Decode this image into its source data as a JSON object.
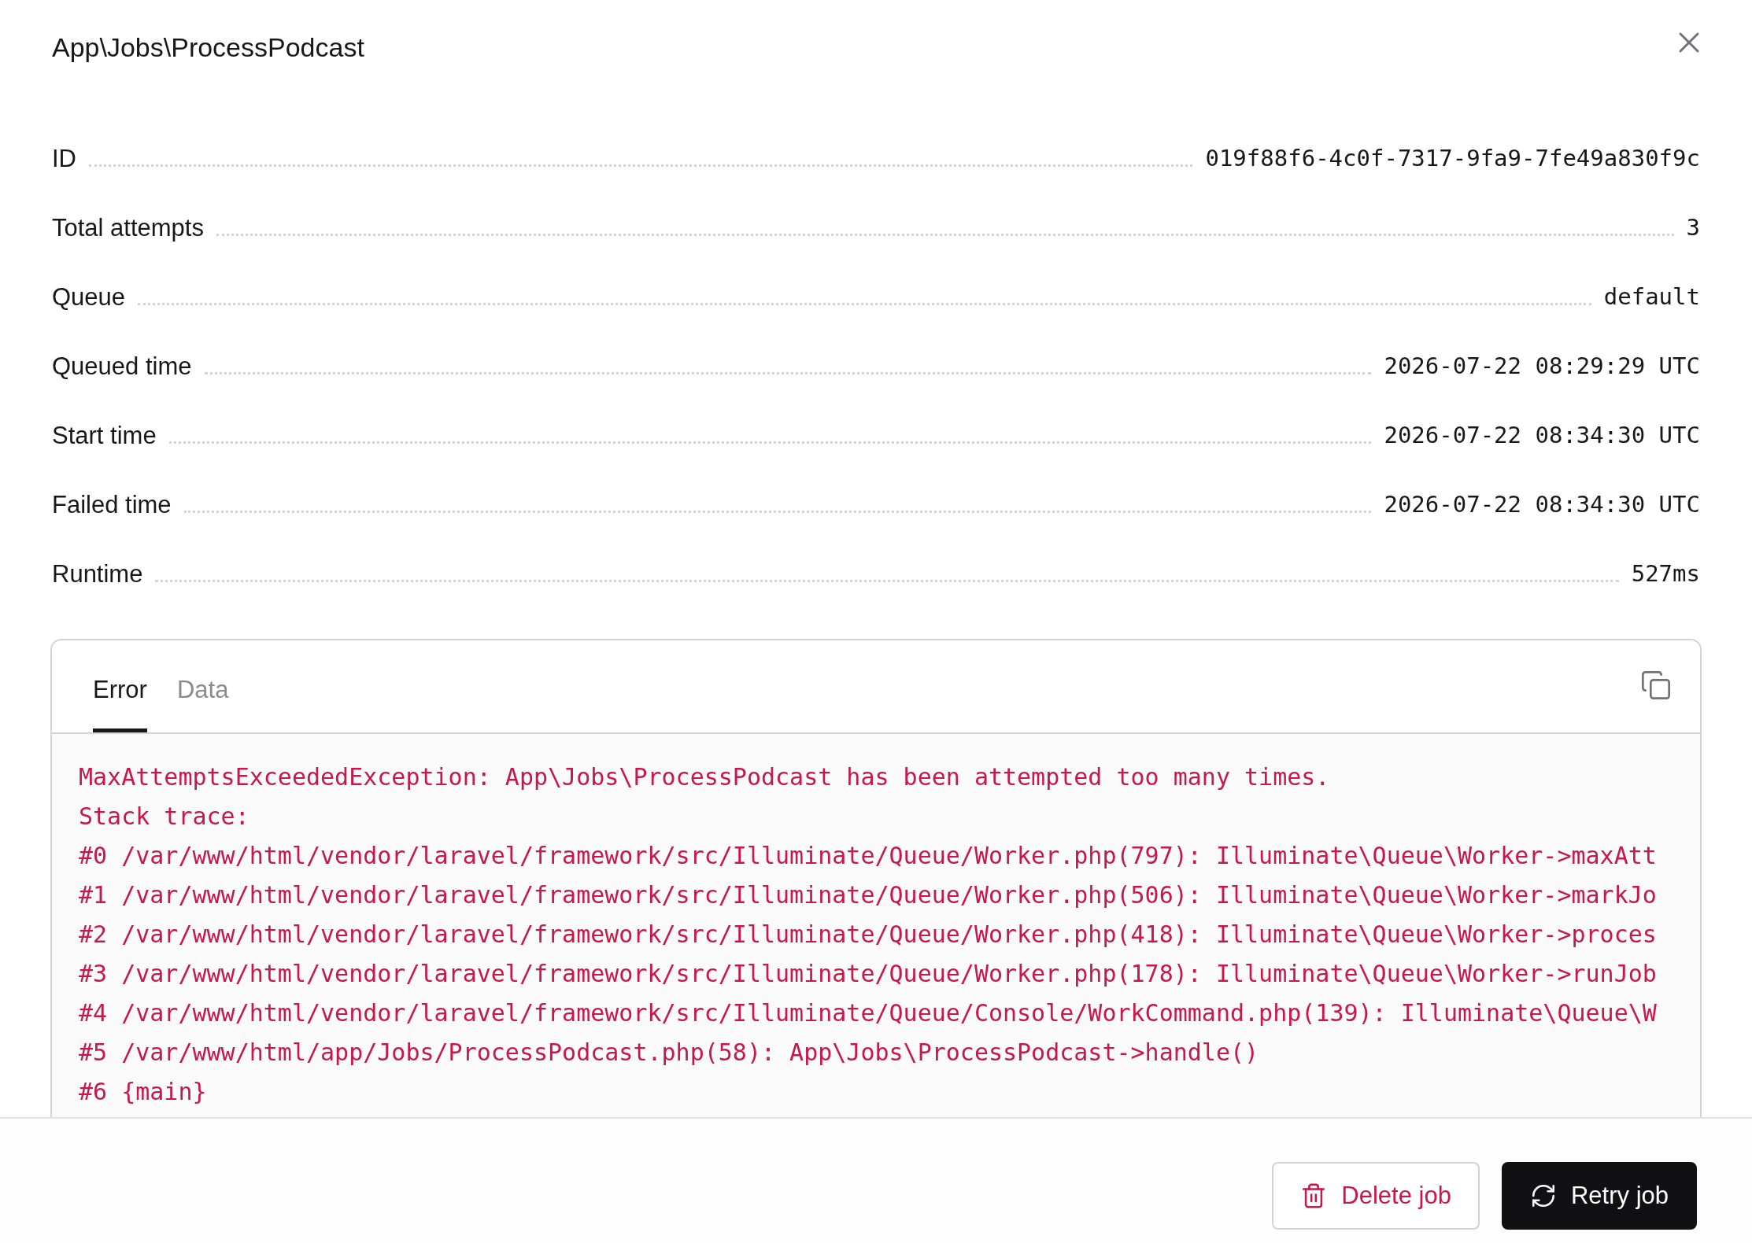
{
  "dialog": {
    "title": "App\\Jobs\\ProcessPodcast"
  },
  "details": [
    {
      "label": "ID",
      "value": "019f88f6-4c0f-7317-9fa9-7fe49a830f9c"
    },
    {
      "label": "Total attempts",
      "value": "3"
    },
    {
      "label": "Queue",
      "value": "default"
    },
    {
      "label": "Queued time",
      "value": "2026-07-22 08:29:29 UTC"
    },
    {
      "label": "Start time",
      "value": "2026-07-22 08:34:30 UTC"
    },
    {
      "label": "Failed time",
      "value": "2026-07-22 08:34:30 UTC"
    },
    {
      "label": "Runtime",
      "value": "527ms"
    }
  ],
  "tabs": [
    {
      "label": "Error",
      "selected": true
    },
    {
      "label": "Data",
      "selected": false
    }
  ],
  "error_output": {
    "lines": [
      "MaxAttemptsExceededException: App\\Jobs\\ProcessPodcast has been attempted too many times.",
      "Stack trace:",
      "#0 /var/www/html/vendor/laravel/framework/src/Illuminate/Queue/Worker.php(797): Illuminate\\Queue\\Worker->maxAtt",
      "#1 /var/www/html/vendor/laravel/framework/src/Illuminate/Queue/Worker.php(506): Illuminate\\Queue\\Worker->markJo",
      "#2 /var/www/html/vendor/laravel/framework/src/Illuminate/Queue/Worker.php(418): Illuminate\\Queue\\Worker->proces",
      "#3 /var/www/html/vendor/laravel/framework/src/Illuminate/Queue/Worker.php(178): Illuminate\\Queue\\Worker->runJob",
      "#4 /var/www/html/vendor/laravel/framework/src/Illuminate/Queue/Console/WorkCommand.php(139): Illuminate\\Queue\\W",
      "#5 /var/www/html/app/Jobs/ProcessPodcast.php(58): App\\Jobs\\ProcessPodcast->handle()",
      "#6 {main}"
    ]
  },
  "buttons": [
    {
      "label": "Delete job",
      "kind": "danger"
    },
    {
      "label": "Retry job",
      "kind": "primary"
    }
  ]
}
